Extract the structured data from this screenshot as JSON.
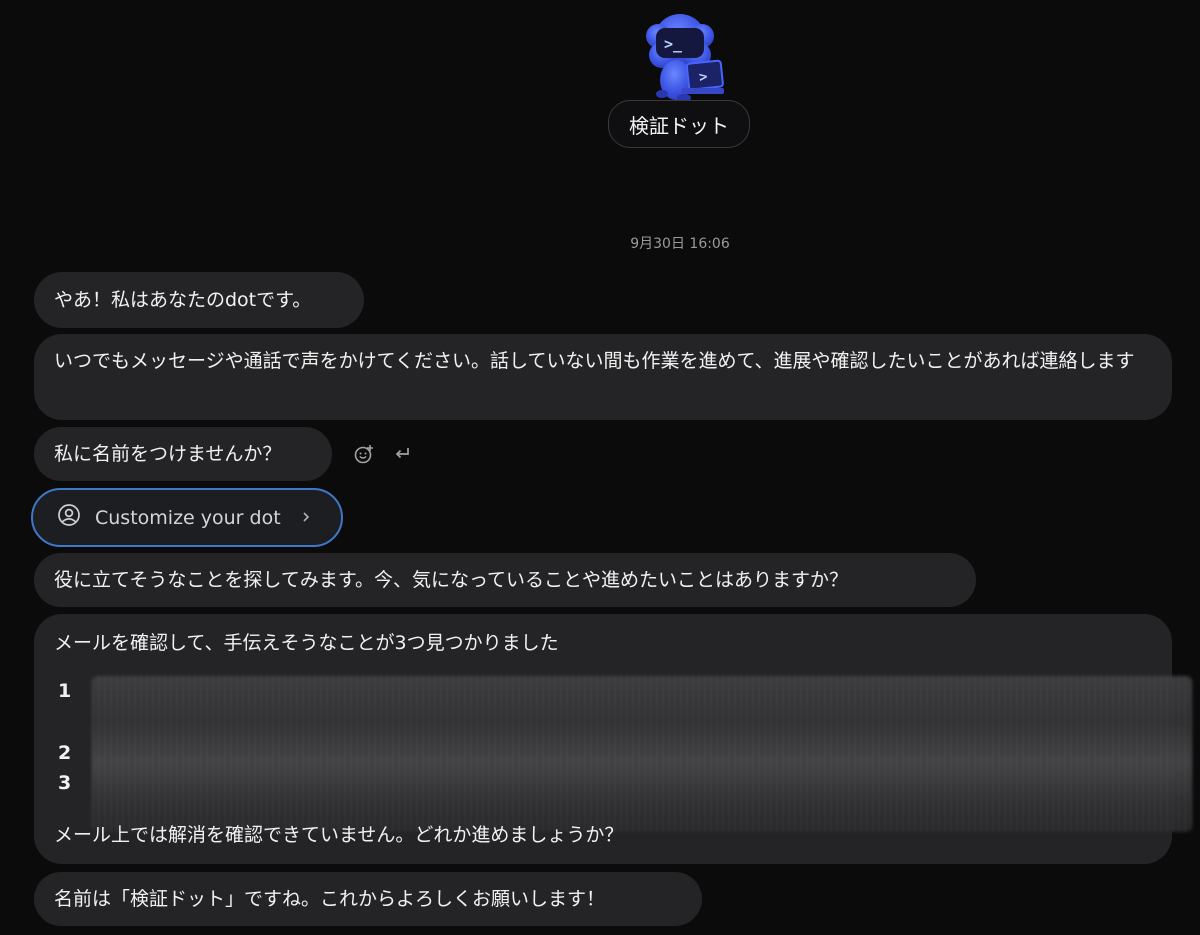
{
  "header": {
    "bot_name": "検証ドット",
    "avatar_icon": "robot-terminal-icon"
  },
  "conversation": {
    "timestamp": "9月30日 16:06",
    "messages": [
      {
        "text": "やあ！私はあなたのdotです。"
      },
      {
        "text": "いつでもメッセージや通話で声をかけてください。話していない間も作業を進めて、進展や確認したいことがあれば連絡します"
      },
      {
        "text": "私に名前をつけませんか？"
      },
      {
        "text": "役に立てそうなことを探してみます。今、気になっていることや進めたいことはありますか？"
      },
      {
        "intro": "メールを確認して、手伝えそうなことが3つ見つかりました",
        "items": [
          "1",
          "2",
          "3"
        ],
        "outro": "メール上では解消を確認できていません。どれか進めましょうか？"
      },
      {
        "text": "名前は「検証ドット」ですね。これからよろしくお願いします！"
      }
    ],
    "message_actions": {
      "react_icon": "add-reaction-icon",
      "reply_icon": "reply-arrow-icon"
    },
    "customize_button": {
      "label": "Customize your dot",
      "icon": "user-circle-icon",
      "chevron": "chevron-right-icon"
    }
  },
  "colors": {
    "background": "#0b0b0c",
    "bubble": "#242426",
    "accent": "#3f78c9",
    "avatar_blue": "#3e57e6"
  }
}
